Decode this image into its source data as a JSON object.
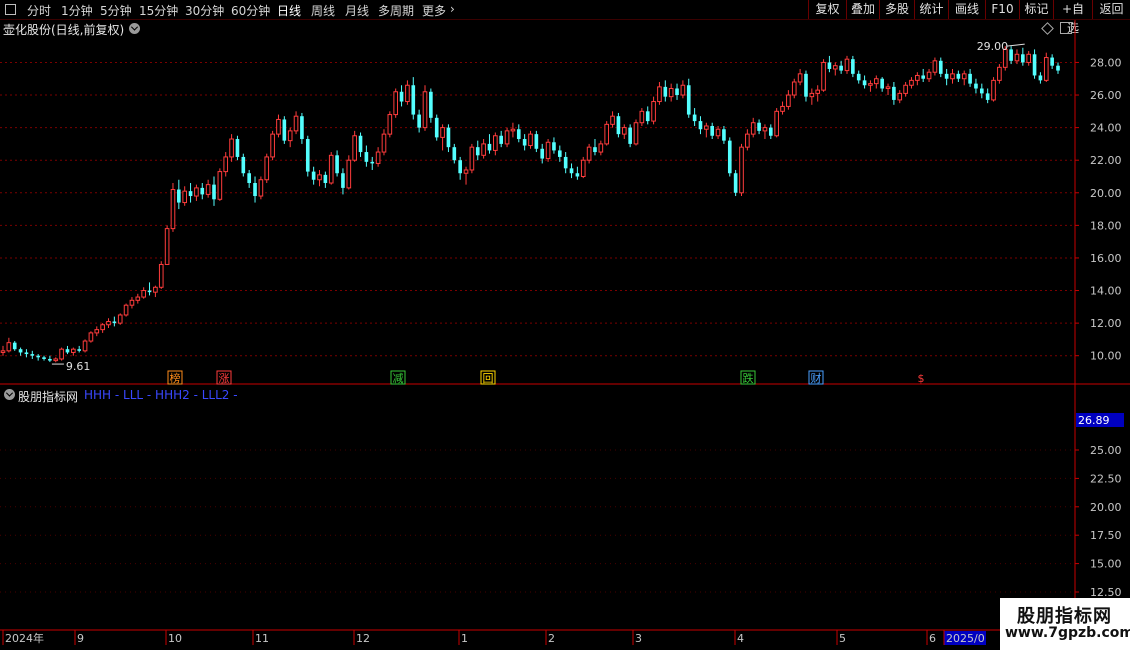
{
  "toolbar": {
    "periods": [
      "分时",
      "1分钟",
      "5分钟",
      "15分钟",
      "30分钟",
      "60分钟",
      "日线",
      "周线",
      "月线",
      "多周期",
      "更多"
    ],
    "active_period": "日线",
    "right_buttons": [
      "复权",
      "叠加",
      "多股",
      "统计",
      "画线",
      "F10",
      "标记",
      "+自选",
      "返回"
    ]
  },
  "main_panel": {
    "title": "壶化股份(日线,前复权)"
  },
  "sub_panel": {
    "title": "股朋指标网",
    "lines_text": "HHH - LLL - HHH2 - LLL2 -",
    "current_value_label": "26.89",
    "y_ticks": [
      "25.00",
      "22.50",
      "20.00",
      "17.50",
      "15.00",
      "12.50"
    ]
  },
  "watermark": {
    "line1": "股朋指标网",
    "line2": "www.7gpzb.com"
  },
  "colors": {
    "up": "#ff3c3c",
    "down": "#54ffff",
    "axis": "#c80000",
    "grid": "#7a0000"
  },
  "chart_data": {
    "type": "candlestick",
    "ylim": [
      9,
      29.5
    ],
    "y_ticks": [
      10,
      12,
      14,
      16,
      18,
      20,
      22,
      24,
      26,
      28
    ],
    "x_labels": [
      "2024年",
      "9",
      "10",
      "11",
      "12",
      "1",
      "2",
      "3",
      "4",
      "5",
      "6",
      "2025/0"
    ],
    "annotations": [
      {
        "text": "9.61",
        "type": "low",
        "price": 9.61
      },
      {
        "text": "29.00",
        "type": "high",
        "price": 29.0
      }
    ],
    "event_markers": [
      {
        "label": "榜",
        "color": "#ff8c1a"
      },
      {
        "label": "涨",
        "color": "#ff3c3c"
      },
      {
        "label": "减",
        "color": "#37c837"
      },
      {
        "label": "回",
        "color": "#ffd700"
      },
      {
        "label": "跌",
        "color": "#37c837"
      },
      {
        "label": "财",
        "color": "#4aa0ff"
      },
      {
        "label": "$",
        "color": "#ff3c3c"
      }
    ],
    "candles": [
      [
        10.2,
        10.6,
        10.0,
        10.3
      ],
      [
        10.3,
        11.1,
        10.2,
        10.8
      ],
      [
        10.8,
        10.9,
        10.3,
        10.4
      ],
      [
        10.4,
        10.5,
        10.0,
        10.2
      ],
      [
        10.2,
        10.4,
        9.9,
        10.1
      ],
      [
        10.1,
        10.3,
        9.8,
        10.0
      ],
      [
        10.0,
        10.1,
        9.7,
        9.9
      ],
      [
        9.9,
        10.0,
        9.7,
        9.8
      ],
      [
        9.8,
        10.0,
        9.61,
        9.7
      ],
      [
        9.7,
        9.9,
        9.6,
        9.8
      ],
      [
        9.8,
        10.5,
        9.7,
        10.4
      ],
      [
        10.4,
        10.6,
        10.1,
        10.2
      ],
      [
        10.2,
        10.5,
        10.0,
        10.4
      ],
      [
        10.4,
        10.6,
        10.2,
        10.3
      ],
      [
        10.3,
        11.0,
        10.2,
        10.9
      ],
      [
        10.9,
        11.5,
        10.8,
        11.4
      ],
      [
        11.4,
        11.8,
        11.2,
        11.6
      ],
      [
        11.6,
        12.0,
        11.4,
        11.9
      ],
      [
        11.9,
        12.3,
        11.7,
        12.1
      ],
      [
        12.1,
        12.4,
        11.8,
        12.0
      ],
      [
        12.0,
        12.6,
        11.9,
        12.5
      ],
      [
        12.5,
        13.2,
        12.4,
        13.1
      ],
      [
        13.1,
        13.6,
        12.9,
        13.4
      ],
      [
        13.4,
        13.8,
        13.2,
        13.6
      ],
      [
        13.6,
        14.2,
        13.5,
        14.0
      ],
      [
        14.0,
        14.5,
        13.7,
        13.9
      ],
      [
        13.9,
        14.3,
        13.6,
        14.2
      ],
      [
        14.2,
        15.8,
        14.1,
        15.6
      ],
      [
        15.6,
        18.0,
        15.8,
        17.8
      ],
      [
        17.8,
        20.6,
        17.6,
        20.2
      ],
      [
        20.2,
        20.8,
        19.0,
        19.4
      ],
      [
        19.4,
        20.4,
        19.2,
        20.1
      ],
      [
        20.1,
        20.6,
        19.4,
        19.8
      ],
      [
        19.8,
        20.5,
        19.5,
        20.3
      ],
      [
        20.3,
        20.6,
        19.6,
        19.9
      ],
      [
        19.9,
        20.8,
        19.7,
        20.5
      ],
      [
        20.5,
        21.0,
        19.2,
        19.6
      ],
      [
        19.6,
        21.5,
        19.5,
        21.3
      ],
      [
        21.3,
        22.5,
        21.0,
        22.2
      ],
      [
        22.2,
        23.6,
        21.9,
        23.3
      ],
      [
        23.3,
        23.5,
        22.0,
        22.2
      ],
      [
        22.2,
        22.4,
        21.0,
        21.2
      ],
      [
        21.2,
        21.4,
        20.3,
        20.6
      ],
      [
        20.6,
        21.0,
        19.4,
        19.8
      ],
      [
        19.8,
        21.0,
        19.6,
        20.8
      ],
      [
        20.8,
        22.4,
        20.6,
        22.2
      ],
      [
        22.2,
        23.8,
        22.0,
        23.6
      ],
      [
        23.6,
        24.8,
        23.4,
        24.5
      ],
      [
        24.5,
        24.7,
        23.0,
        23.2
      ],
      [
        23.2,
        24.0,
        22.8,
        23.8
      ],
      [
        23.8,
        25.0,
        23.6,
        24.7
      ],
      [
        24.7,
        24.9,
        23.0,
        23.3
      ],
      [
        23.3,
        23.5,
        21.0,
        21.3
      ],
      [
        21.3,
        21.6,
        20.5,
        20.8
      ],
      [
        20.8,
        21.4,
        20.4,
        21.1
      ],
      [
        21.1,
        21.3,
        20.3,
        20.6
      ],
      [
        20.6,
        22.5,
        20.5,
        22.3
      ],
      [
        22.3,
        22.6,
        21.0,
        21.2
      ],
      [
        21.2,
        21.5,
        19.9,
        20.3
      ],
      [
        20.3,
        22.3,
        20.2,
        22.0
      ],
      [
        22.0,
        23.8,
        21.9,
        23.5
      ],
      [
        23.5,
        23.7,
        22.2,
        22.5
      ],
      [
        22.5,
        22.9,
        21.6,
        21.9
      ],
      [
        21.9,
        22.2,
        21.4,
        21.8
      ],
      [
        21.8,
        22.8,
        21.6,
        22.5
      ],
      [
        22.5,
        23.9,
        22.3,
        23.6
      ],
      [
        23.6,
        25.0,
        23.4,
        24.8
      ],
      [
        24.8,
        26.4,
        24.6,
        26.2
      ],
      [
        26.2,
        26.6,
        25.3,
        25.6
      ],
      [
        25.6,
        26.9,
        25.4,
        26.6
      ],
      [
        26.6,
        27.1,
        24.5,
        24.8
      ],
      [
        24.8,
        25.1,
        23.7,
        24.0
      ],
      [
        24.0,
        26.6,
        23.8,
        26.2
      ],
      [
        26.2,
        26.4,
        24.3,
        24.6
      ],
      [
        24.6,
        24.8,
        23.2,
        23.4
      ],
      [
        23.4,
        24.2,
        22.6,
        24.0
      ],
      [
        24.0,
        24.2,
        22.5,
        22.8
      ],
      [
        22.8,
        23.0,
        21.8,
        22.0
      ],
      [
        22.0,
        22.2,
        20.8,
        21.2
      ],
      [
        21.2,
        21.6,
        20.5,
        21.4
      ],
      [
        21.4,
        23.0,
        21.2,
        22.8
      ],
      [
        22.8,
        23.2,
        22.0,
        22.3
      ],
      [
        22.3,
        23.3,
        22.1,
        23.0
      ],
      [
        23.0,
        23.6,
        22.4,
        22.6
      ],
      [
        22.6,
        23.7,
        22.3,
        23.5
      ],
      [
        23.5,
        23.8,
        22.8,
        23.0
      ],
      [
        23.0,
        24.0,
        22.8,
        23.8
      ],
      [
        23.8,
        24.3,
        23.4,
        23.9
      ],
      [
        23.9,
        24.2,
        23.1,
        23.3
      ],
      [
        23.3,
        23.6,
        22.6,
        22.9
      ],
      [
        22.9,
        23.8,
        22.7,
        23.6
      ],
      [
        23.6,
        23.8,
        22.5,
        22.7
      ],
      [
        22.7,
        23.0,
        21.8,
        22.1
      ],
      [
        22.1,
        23.3,
        21.9,
        23.1
      ],
      [
        23.1,
        23.4,
        22.4,
        22.6
      ],
      [
        22.6,
        22.9,
        21.9,
        22.2
      ],
      [
        22.2,
        22.5,
        21.2,
        21.5
      ],
      [
        21.5,
        21.8,
        20.9,
        21.2
      ],
      [
        21.2,
        21.6,
        20.8,
        21.0
      ],
      [
        21.0,
        22.2,
        20.9,
        22.0
      ],
      [
        22.0,
        23.0,
        21.8,
        22.8
      ],
      [
        22.8,
        23.3,
        22.3,
        22.5
      ],
      [
        22.5,
        23.2,
        22.3,
        23.0
      ],
      [
        23.0,
        24.4,
        22.9,
        24.2
      ],
      [
        24.2,
        25.0,
        24.0,
        24.7
      ],
      [
        24.7,
        24.9,
        23.4,
        23.6
      ],
      [
        23.6,
        24.2,
        23.3,
        24.0
      ],
      [
        24.0,
        24.2,
        22.8,
        23.0
      ],
      [
        23.0,
        24.5,
        22.9,
        24.3
      ],
      [
        24.3,
        25.2,
        24.1,
        25.0
      ],
      [
        25.0,
        25.3,
        24.2,
        24.4
      ],
      [
        24.4,
        25.9,
        24.2,
        25.6
      ],
      [
        25.6,
        26.8,
        25.4,
        26.5
      ],
      [
        26.5,
        26.9,
        25.6,
        25.9
      ],
      [
        25.9,
        26.7,
        25.6,
        26.4
      ],
      [
        26.4,
        26.7,
        25.7,
        26.0
      ],
      [
        26.0,
        26.9,
        25.8,
        26.6
      ],
      [
        26.6,
        27.0,
        24.6,
        24.8
      ],
      [
        24.8,
        25.2,
        24.1,
        24.4
      ],
      [
        24.4,
        24.7,
        23.6,
        23.9
      ],
      [
        23.9,
        24.3,
        23.4,
        24.1
      ],
      [
        24.1,
        24.3,
        23.3,
        23.5
      ],
      [
        23.5,
        24.1,
        23.3,
        23.9
      ],
      [
        23.9,
        24.1,
        23.0,
        23.2
      ],
      [
        23.2,
        23.4,
        21.0,
        21.2
      ],
      [
        21.2,
        21.4,
        19.8,
        20.0
      ],
      [
        20.0,
        23.0,
        19.8,
        22.8
      ],
      [
        22.8,
        23.9,
        22.6,
        23.6
      ],
      [
        23.6,
        24.6,
        23.4,
        24.3
      ],
      [
        24.3,
        24.5,
        23.6,
        23.8
      ],
      [
        23.8,
        24.2,
        23.3,
        24.0
      ],
      [
        24.0,
        24.2,
        23.3,
        23.5
      ],
      [
        23.5,
        25.2,
        23.4,
        25.0
      ],
      [
        25.0,
        25.6,
        24.8,
        25.3
      ],
      [
        25.3,
        26.3,
        25.1,
        26.0
      ],
      [
        26.0,
        27.0,
        25.8,
        26.8
      ],
      [
        26.8,
        27.6,
        26.6,
        27.3
      ],
      [
        27.3,
        27.5,
        25.6,
        25.9
      ],
      [
        25.9,
        26.4,
        25.4,
        26.1
      ],
      [
        26.1,
        26.6,
        25.6,
        26.3
      ],
      [
        26.3,
        28.2,
        26.2,
        28.0
      ],
      [
        28.0,
        28.4,
        27.4,
        27.6
      ],
      [
        27.6,
        28.0,
        27.2,
        27.8
      ],
      [
        27.8,
        28.1,
        27.3,
        27.5
      ],
      [
        27.5,
        28.4,
        27.3,
        28.2
      ],
      [
        28.2,
        28.4,
        27.1,
        27.3
      ],
      [
        27.3,
        27.5,
        26.7,
        26.9
      ],
      [
        26.9,
        27.2,
        26.4,
        26.6
      ],
      [
        26.6,
        26.9,
        26.2,
        26.7
      ],
      [
        26.7,
        27.2,
        26.4,
        27.0
      ],
      [
        27.0,
        27.1,
        26.2,
        26.4
      ],
      [
        26.4,
        26.7,
        26.0,
        26.5
      ],
      [
        26.5,
        26.8,
        25.4,
        25.7
      ],
      [
        25.7,
        26.3,
        25.5,
        26.1
      ],
      [
        26.1,
        26.8,
        25.9,
        26.6
      ],
      [
        26.6,
        27.1,
        26.4,
        26.9
      ],
      [
        26.9,
        27.4,
        26.6,
        27.2
      ],
      [
        27.2,
        27.6,
        26.8,
        27.0
      ],
      [
        27.0,
        27.6,
        26.8,
        27.4
      ],
      [
        27.4,
        28.3,
        27.2,
        28.1
      ],
      [
        28.1,
        28.3,
        27.1,
        27.3
      ],
      [
        27.3,
        27.6,
        26.6,
        27.0
      ],
      [
        27.0,
        27.6,
        26.7,
        27.3
      ],
      [
        27.3,
        27.5,
        26.8,
        27.0
      ],
      [
        27.0,
        27.5,
        26.6,
        27.3
      ],
      [
        27.3,
        27.6,
        26.5,
        26.7
      ],
      [
        26.7,
        27.0,
        26.1,
        26.4
      ],
      [
        26.4,
        26.7,
        25.8,
        26.1
      ],
      [
        26.1,
        26.4,
        25.5,
        25.7
      ],
      [
        25.7,
        27.1,
        25.6,
        26.9
      ],
      [
        26.9,
        27.9,
        26.7,
        27.7
      ],
      [
        27.7,
        29.0,
        27.5,
        28.8
      ],
      [
        28.8,
        29.0,
        27.9,
        28.1
      ],
      [
        28.1,
        28.8,
        27.9,
        28.5
      ],
      [
        28.5,
        28.9,
        27.8,
        28.0
      ],
      [
        28.0,
        28.7,
        27.8,
        28.5
      ],
      [
        28.5,
        28.8,
        27.0,
        27.2
      ],
      [
        27.2,
        27.4,
        26.7,
        26.9
      ],
      [
        26.9,
        28.6,
        26.8,
        28.3
      ],
      [
        28.3,
        28.5,
        27.6,
        27.8
      ],
      [
        27.8,
        28.0,
        27.3,
        27.5
      ]
    ]
  }
}
